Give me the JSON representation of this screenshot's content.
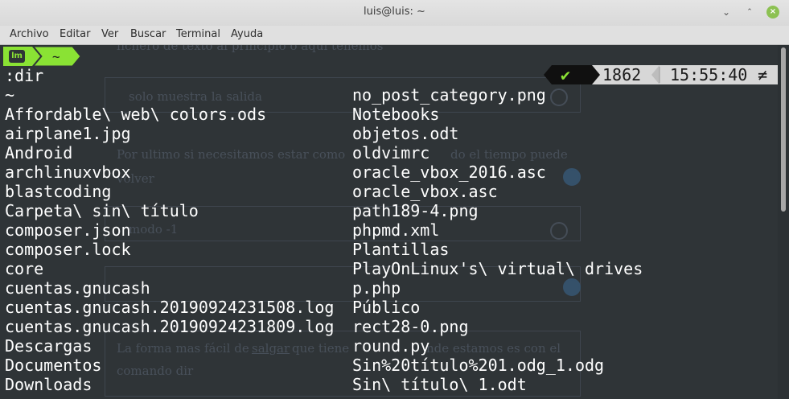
{
  "window": {
    "title": "luis@luis: ~",
    "minimize_glyph": "⌄",
    "maximize_glyph": "⌃",
    "close_glyph": "×"
  },
  "menu": {
    "items": [
      "Archivo",
      "Editar",
      "Ver",
      "Buscar",
      "Terminal",
      "Ayuda"
    ]
  },
  "prompt": {
    "mint_glyph": "lm",
    "path": "~"
  },
  "status": {
    "check": "✔",
    "count": "1862",
    "time": "15:55:40",
    "noteq": "≠"
  },
  "command": ":dir",
  "listing": {
    "left": [
      "~",
      "Affordable\\ web\\ colors.ods",
      "airplane1.jpg",
      "Android",
      "archlinuxvbox",
      "blastcoding",
      "Carpeta\\ sin\\ título",
      "composer.json",
      "composer.lock",
      "core",
      "cuentas.gnucash",
      "cuentas.gnucash.20190924231508.log",
      "cuentas.gnucash.20190924231809.log",
      "Descargas",
      "Documentos",
      "Downloads"
    ],
    "right": [
      "no_post_category.png",
      "Notebooks",
      "objetos.odt",
      "oldvimrc",
      "oracle_vbox_2016.asc",
      "oracle_vbox.asc",
      "path189-4.png",
      "phpmd.xml",
      "Plantillas",
      "PlayOnLinux's\\ virtual\\ drives",
      "p.php",
      "Público",
      "rect28-0.png",
      "round.py",
      "Sin%20título%201.odg_1.odg",
      "Sin\\ título\\ 1.odt"
    ]
  },
  "background_text": {
    "line1": "fichero de texto al principio o aqui tenemos",
    "line2": "solo muestra la salida",
    "line3": "Por ultimo si necesitamos estar como",
    "line3b": "do el tiempo puede",
    "line4": "volver",
    "line5": "modo -1",
    "line6": "La forma mas fácil de",
    "line6_link": "salgar",
    "line6b": "que tiene",
    "line6c": "nde estamos es con el",
    "line7": "comando dir"
  }
}
